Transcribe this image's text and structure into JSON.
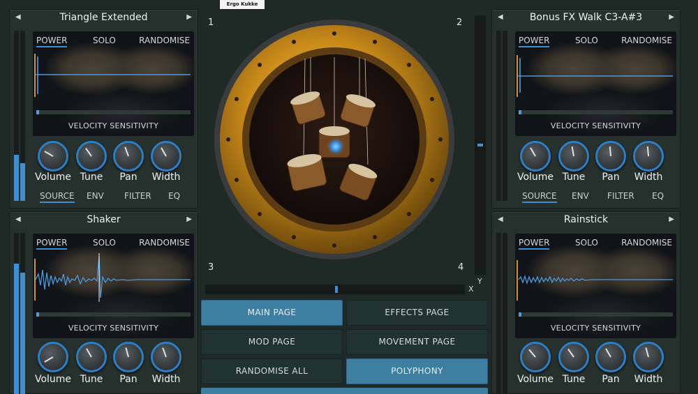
{
  "top_logo": "Ergo Kukke",
  "panels": {
    "tl": {
      "title": "Triangle Extended",
      "tabs": [
        "POWER",
        "SOLO",
        "RANDOMISE"
      ],
      "label": "VELOCITY SENSITIVITY",
      "knobs": [
        "Volume",
        "Tune",
        "Pan",
        "Width"
      ],
      "bottom_tabs": [
        "SOURCE",
        "ENV",
        "FILTER",
        "EQ"
      ]
    },
    "tr": {
      "title": "Bonus FX Walk C3-A#3",
      "tabs": [
        "POWER",
        "SOLO",
        "RANDOMISE"
      ],
      "label": "VELOCITY SENSITIVITY",
      "knobs": [
        "Volume",
        "Tune",
        "Pan",
        "Width"
      ],
      "bottom_tabs": [
        "SOURCE",
        "ENV",
        "FILTER",
        "EQ"
      ]
    },
    "bl": {
      "title": "Shaker",
      "tabs": [
        "POWER",
        "SOLO",
        "RANDOMISE"
      ],
      "label": "VELOCITY SENSITIVITY",
      "knobs": [
        "Volume",
        "Tune",
        "Pan",
        "Width"
      ]
    },
    "br": {
      "title": "Rainstick",
      "tabs": [
        "POWER",
        "SOLO",
        "RANDOMISE"
      ],
      "label": "VELOCITY SENSITIVITY",
      "knobs": [
        "Volume",
        "Tune",
        "Pan",
        "Width"
      ]
    }
  },
  "pad": {
    "corners": [
      "1",
      "2",
      "3",
      "4"
    ],
    "axis_x": "X",
    "axis_y": "Y"
  },
  "nav": {
    "main": "MAIN PAGE",
    "effects": "EFFECTS PAGE",
    "mod": "MOD PAGE",
    "movement": "MOVEMENT PAGE",
    "randomise_all": "RANDOMISE ALL",
    "polyphony": "POLYPHONY"
  },
  "colors": {
    "accent": "#3f8fd0",
    "gold": "#c8901c",
    "panel": "#26312e"
  }
}
